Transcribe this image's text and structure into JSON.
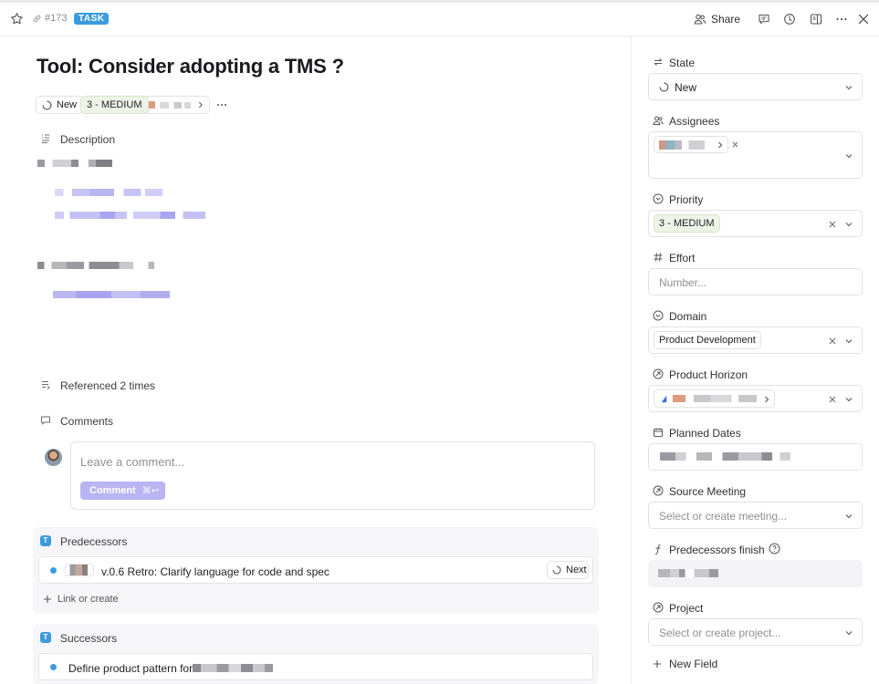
{
  "topbar": {
    "issue_number": "#173",
    "type_badge": "TASK",
    "share_label": "Share"
  },
  "issue": {
    "title": "Tool: Consider adopting a TMS ?",
    "status_chip": "New",
    "priority_chip": "3 - MEDIUM"
  },
  "description": {
    "label": "Description"
  },
  "references": {
    "label": "Referenced 2 times"
  },
  "comments": {
    "label": "Comments",
    "placeholder": "Leave a comment...",
    "button_label": "Comment",
    "shortcut": "⌘↩"
  },
  "predecessors": {
    "label": "Predecessors",
    "items": [
      {
        "title": "v.0.6 Retro: Clarify language for code and spec",
        "status": "Next"
      }
    ],
    "link_label": "Link or create"
  },
  "successors": {
    "label": "Successors",
    "items": [
      {
        "title": "Define product pattern for"
      }
    ]
  },
  "properties": {
    "state": {
      "label": "State",
      "value": "New"
    },
    "assignees": {
      "label": "Assignees"
    },
    "priority": {
      "label": "Priority",
      "value": "3 - MEDIUM"
    },
    "effort": {
      "label": "Effort",
      "placeholder": "Number..."
    },
    "domain": {
      "label": "Domain",
      "value": "Product Development"
    },
    "product_horizon": {
      "label": "Product Horizon"
    },
    "planned_dates": {
      "label": "Planned Dates"
    },
    "source_meeting": {
      "label": "Source Meeting",
      "placeholder": "Select or create meeting..."
    },
    "predecessors_finish": {
      "label": "Predecessors finish"
    },
    "project": {
      "label": "Project",
      "placeholder": "Select or create project..."
    },
    "new_field_label": "New Field"
  },
  "colors": {
    "accent": "#3d9bdc",
    "comment_button": "#b9b4f2",
    "priority_bg": "#eef5e8",
    "blurred_text": "#c7c5f5"
  },
  "icons": [
    "star-icon",
    "link-icon",
    "share-people-icon",
    "comment-icon",
    "history-icon",
    "panel-icon",
    "more-icon",
    "close-icon",
    "state-icon",
    "priority-icon",
    "hash-icon",
    "calendar-icon",
    "help-icon"
  ]
}
